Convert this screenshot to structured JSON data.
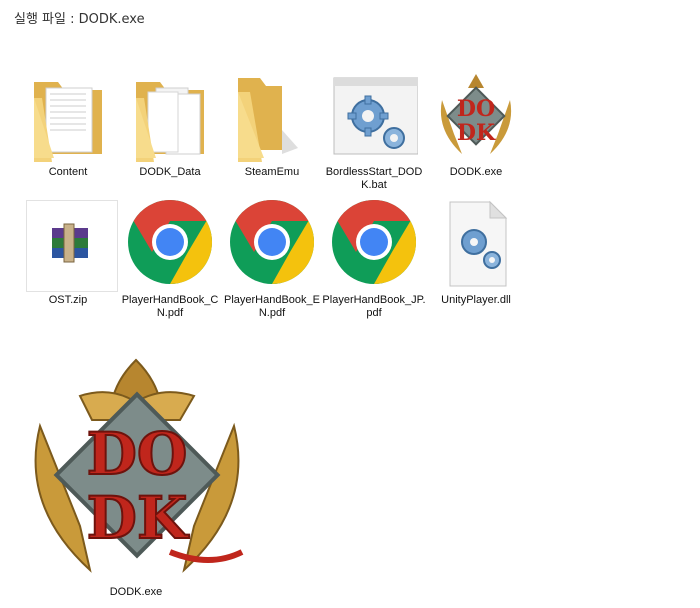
{
  "caption": "실행 파일 : DODK.exe",
  "files": [
    {
      "label": "Content",
      "icon": "folder-icon"
    },
    {
      "label": "DODK_Data",
      "icon": "folder-icon"
    },
    {
      "label": "SteamEmu",
      "icon": "folder-icon"
    },
    {
      "label": "BordlessStart_DODK.bat",
      "icon": "batch-file-icon"
    },
    {
      "label": "DODK.exe",
      "icon": "dodk-logo-icon"
    },
    {
      "label": "OST.zip",
      "icon": "winrar-archive-icon"
    },
    {
      "label": "PlayerHandBook_CN.pdf",
      "icon": "chrome-pdf-icon"
    },
    {
      "label": "PlayerHandBook_EN.pdf",
      "icon": "chrome-pdf-icon"
    },
    {
      "label": "PlayerHandBook_JP.pdf",
      "icon": "chrome-pdf-icon"
    },
    {
      "label": "UnityPlayer.dll",
      "icon": "dll-file-icon"
    }
  ],
  "featured": {
    "label": "DODK.exe",
    "icon": "dodk-logo-icon"
  },
  "colors": {
    "folder_yellow": "#f3d27a",
    "folder_dark": "#e0b24e",
    "chrome_red": "#db4437",
    "chrome_yellow": "#f4c20d",
    "chrome_green": "#0f9d58",
    "chrome_blue": "#4285f4",
    "gear_blue": "#6f9fd0",
    "logo_red": "#c0261c",
    "logo_gold": "#c99a3a",
    "logo_stone": "#7d8c8a"
  }
}
